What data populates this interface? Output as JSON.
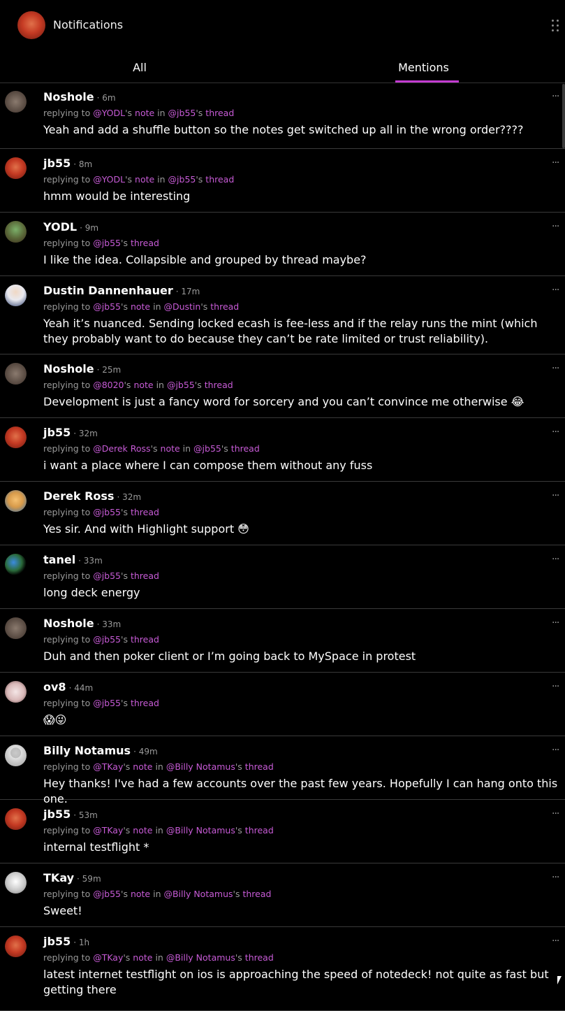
{
  "header": {
    "title": "Notifications",
    "avatar_icon": "user-avatar-icon",
    "menu_icon": "drag-grip-icon"
  },
  "tabs": [
    {
      "label": "All",
      "active": false
    },
    {
      "label": "Mentions",
      "active": true
    }
  ],
  "accent_color": "#c33bd2",
  "notifications": [
    {
      "name": "Noshole",
      "time": "· 6m",
      "avatar": "noshole",
      "reply": [
        [
          "replying to ",
          false
        ],
        [
          "@YODL",
          true
        ],
        [
          "'s ",
          false
        ],
        [
          "note",
          true
        ],
        [
          " in ",
          false
        ],
        [
          "@jb55",
          true
        ],
        [
          "'s ",
          false
        ],
        [
          "thread",
          true
        ]
      ],
      "body": "Yeah and add a shuffle button so the notes get switched up all in the wrong order????",
      "height": 95
    },
    {
      "name": "jb55",
      "time": "· 8m",
      "avatar": "jb55",
      "reply": [
        [
          "replying to ",
          false
        ],
        [
          "@YODL",
          true
        ],
        [
          "'s ",
          false
        ],
        [
          "note",
          true
        ],
        [
          " in ",
          false
        ],
        [
          "@jb55",
          true
        ],
        [
          "'s ",
          false
        ],
        [
          "thread",
          true
        ]
      ],
      "body": "hmm would be interesting",
      "height": 91
    },
    {
      "name": "YODL",
      "time": "· 9m",
      "avatar": "yodl",
      "reply": [
        [
          "replying to ",
          false
        ],
        [
          "@jb55",
          true
        ],
        [
          "'s ",
          false
        ],
        [
          "thread",
          true
        ]
      ],
      "body": "I like the idea. Collapsible and grouped by thread maybe?",
      "height": 91
    },
    {
      "name": "Dustin Dannenhauer",
      "time": "· 17m",
      "avatar": "dustin",
      "reply": [
        [
          "replying to ",
          false
        ],
        [
          "@jb55",
          true
        ],
        [
          "'s ",
          false
        ],
        [
          "note",
          true
        ],
        [
          " in ",
          false
        ],
        [
          "@Dustin",
          true
        ],
        [
          "'s ",
          false
        ],
        [
          "thread",
          true
        ]
      ],
      "body": "Yeah it’s nuanced. Sending locked ecash is fee-less and if the relay runs the mint (which they probably want to do because they can’t be rate limited or trust reliability).",
      "height": 112
    },
    {
      "name": "Noshole",
      "time": "· 25m",
      "avatar": "noshole",
      "reply": [
        [
          "replying to ",
          false
        ],
        [
          "@8020",
          true
        ],
        [
          "'s ",
          false
        ],
        [
          "note",
          true
        ],
        [
          " in ",
          false
        ],
        [
          "@jb55",
          true
        ],
        [
          "'s ",
          false
        ],
        [
          "thread",
          true
        ]
      ],
      "body": "Development is just a fancy word for sorcery and you can’t convince me otherwise 😂",
      "height": 91
    },
    {
      "name": "jb55",
      "time": "· 32m",
      "avatar": "jb55",
      "reply": [
        [
          "replying to ",
          false
        ],
        [
          "@Derek Ross",
          true
        ],
        [
          "'s ",
          false
        ],
        [
          "note",
          true
        ],
        [
          " in ",
          false
        ],
        [
          "@jb55",
          true
        ],
        [
          "'s ",
          false
        ],
        [
          "thread",
          true
        ]
      ],
      "body": "i want a place where I can compose them without any fuss",
      "height": 91
    },
    {
      "name": "Derek Ross",
      "time": "· 32m",
      "avatar": "derek",
      "reply": [
        [
          "replying to ",
          false
        ],
        [
          "@jb55",
          true
        ],
        [
          "'s ",
          false
        ],
        [
          "thread",
          true
        ]
      ],
      "body": "Yes sir. And with Highlight support 😳",
      "height": 91
    },
    {
      "name": "tanel",
      "time": "· 33m",
      "avatar": "tanel",
      "reply": [
        [
          "replying to ",
          false
        ],
        [
          "@jb55",
          true
        ],
        [
          "'s ",
          false
        ],
        [
          "thread",
          true
        ]
      ],
      "body": "long deck energy",
      "height": 91
    },
    {
      "name": "Noshole",
      "time": "· 33m",
      "avatar": "noshole",
      "reply": [
        [
          "replying to ",
          false
        ],
        [
          "@jb55",
          true
        ],
        [
          "'s ",
          false
        ],
        [
          "thread",
          true
        ]
      ],
      "body": "Duh and then poker client or I’m going back to MySpace in protest",
      "height": 91
    },
    {
      "name": "ov8",
      "time": "· 44m",
      "avatar": "ov8",
      "reply": [
        [
          "replying to ",
          false
        ],
        [
          "@jb55",
          true
        ],
        [
          "'s ",
          false
        ],
        [
          "thread",
          true
        ]
      ],
      "body": "😱😜",
      "height": 91
    },
    {
      "name": "Billy Notamus",
      "time": "· 49m",
      "avatar": "billy",
      "reply": [
        [
          "replying to ",
          false
        ],
        [
          "@TKay",
          true
        ],
        [
          "'s ",
          false
        ],
        [
          "note",
          true
        ],
        [
          " in ",
          false
        ],
        [
          "@Billy Notamus",
          true
        ],
        [
          "'s ",
          false
        ],
        [
          "thread",
          true
        ]
      ],
      "body": "Hey thanks! I've had a few accounts over the past few years. Hopefully I can hang onto this one.",
      "height": 91
    },
    {
      "name": "jb55",
      "time": "· 53m",
      "avatar": "jb55",
      "reply": [
        [
          "replying to ",
          false
        ],
        [
          "@TKay",
          true
        ],
        [
          "'s ",
          false
        ],
        [
          "note",
          true
        ],
        [
          " in ",
          false
        ],
        [
          "@Billy Notamus",
          true
        ],
        [
          "'s ",
          false
        ],
        [
          "thread",
          true
        ]
      ],
      "body": "internal testflight *",
      "height": 91
    },
    {
      "name": "TKay",
      "time": "· 59m",
      "avatar": "tkay",
      "reply": [
        [
          "replying to ",
          false
        ],
        [
          "@jb55",
          true
        ],
        [
          "'s ",
          false
        ],
        [
          "note",
          true
        ],
        [
          " in ",
          false
        ],
        [
          "@Billy Notamus",
          true
        ],
        [
          "'s ",
          false
        ],
        [
          "thread",
          true
        ]
      ],
      "body": "Sweet!",
      "height": 91
    },
    {
      "name": "jb55",
      "time": "· 1h",
      "avatar": "jb55",
      "reply": [
        [
          "replying to ",
          false
        ],
        [
          "@TKay",
          true
        ],
        [
          "'s ",
          false
        ],
        [
          "note",
          true
        ],
        [
          " in ",
          false
        ],
        [
          "@Billy Notamus",
          true
        ],
        [
          "'s ",
          false
        ],
        [
          "thread",
          true
        ]
      ],
      "body": "latest internet testflight on ios is approaching the speed of notedeck! not quite as fast but getting there",
      "height": 120
    }
  ]
}
